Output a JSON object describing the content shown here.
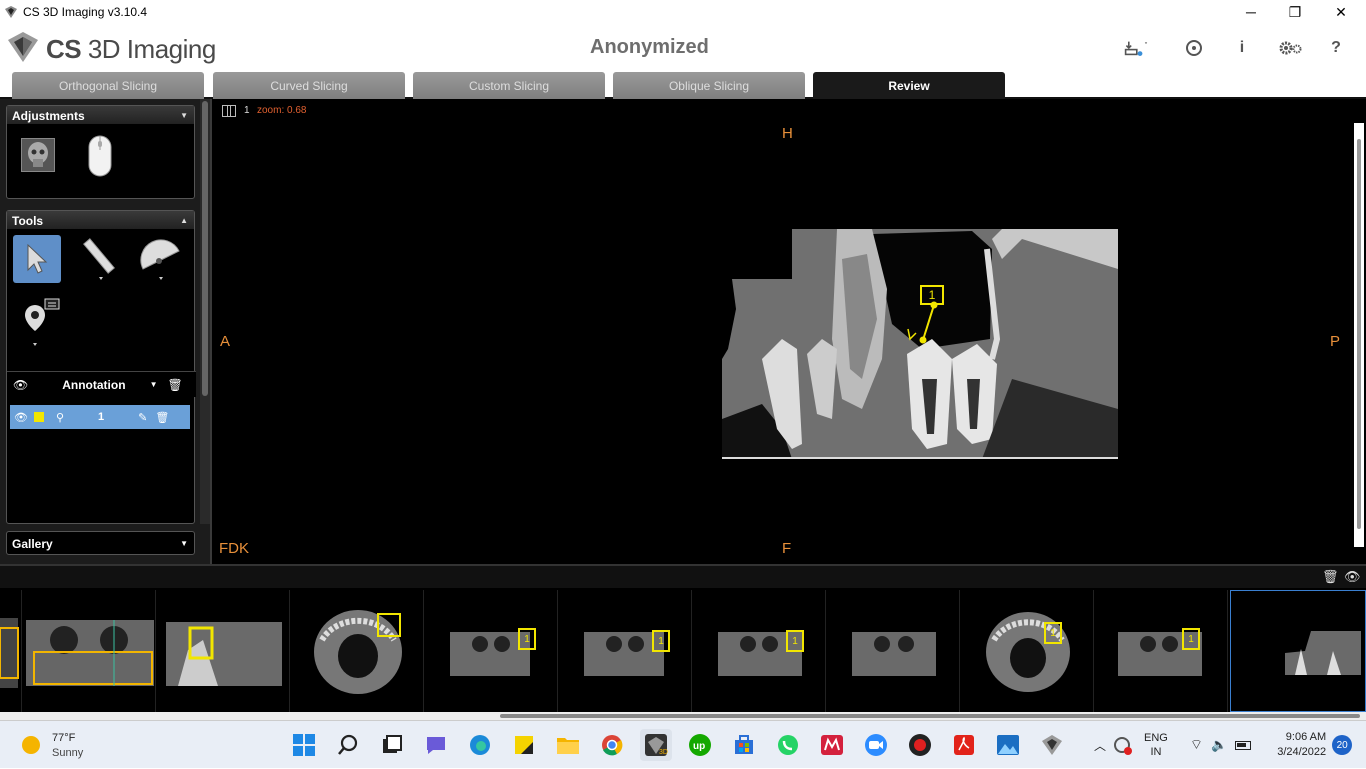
{
  "window": {
    "title": "CS 3D Imaging v3.10.4"
  },
  "header": {
    "logo_bold": "CS",
    "logo_rest": " 3D Imaging",
    "patient": "Anonymized"
  },
  "tabs": [
    {
      "label": "Orthogonal Slicing"
    },
    {
      "label": "Curved Slicing"
    },
    {
      "label": "Custom Slicing"
    },
    {
      "label": "Oblique Slicing"
    },
    {
      "label": "Review"
    }
  ],
  "left_panel": {
    "adjustments": "Adjustments",
    "tools": "Tools",
    "annotation": "Annotation",
    "annotation_item": "1",
    "gallery": "Gallery"
  },
  "viewer": {
    "layout_index": "1",
    "zoom": "zoom: 0.68",
    "orient_top": "H",
    "orient_bottom": "F",
    "orient_left": "A",
    "orient_right": "P",
    "filter": "FDK",
    "marker_label": "1"
  },
  "gallery_marker": "1",
  "taskbar": {
    "temp": "77°F",
    "condition": "Sunny",
    "lang": "ENG",
    "region": "IN",
    "time": "9:06 AM",
    "date": "3/24/2022",
    "notif": "20"
  },
  "colors": {
    "accent_orange": "#e8903a",
    "annotation_yellow": "#f2e600",
    "selected_blue": "#6aa0d8"
  }
}
